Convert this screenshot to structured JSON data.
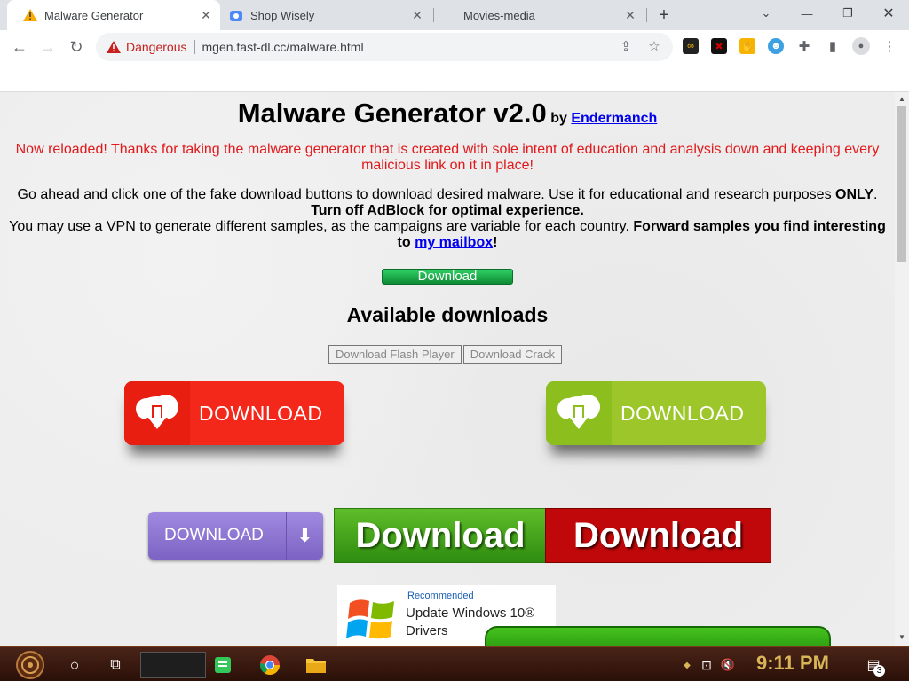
{
  "tabs": [
    {
      "label": "Malware Generator",
      "active": true,
      "icon": "warning-icon"
    },
    {
      "label": "Shop Wisely",
      "active": false,
      "icon": "shop-icon"
    },
    {
      "label": "Movies-media",
      "active": false,
      "icon": ""
    }
  ],
  "omnibox": {
    "security_label": "Dangerous",
    "url": "mgen.fast-dl.cc/malware.html"
  },
  "page": {
    "title": "Malware Generator v2.0",
    "by_prefix": "by",
    "author_link": "Endermanch",
    "red_strong": "Now reloaded!",
    "red_text": " Thanks for taking the malware generator that is created with sole intent of education and analysis down and keeping every malicious link on it in place!",
    "p1_text": "Go ahead and click one of the fake download buttons to download desired malware. Use it for educational and research purposes ",
    "p1_strong": "ONLY",
    "p1_end": ".",
    "p2_strong": "Turn off AdBlock for optimal experience.",
    "p3_text": "You may use a VPN to generate different samples, as the campaigns are variable for each country. ",
    "p3_strong": "Forward samples you find interesting to ",
    "p3_link": "my mailbox",
    "p3_end": "!",
    "download_button": "Download",
    "available_heading": "Available downloads",
    "flash_button": "Download Flash Player",
    "crack_button": "Download Crack",
    "ad_red_label": "DOWNLOAD",
    "ad_lime_label": "DOWNLOAD",
    "ad_purple_label": "DOWNLOAD",
    "ad_green_label": "Download",
    "ad_darkred_label": "Download",
    "win_ad_recommended": "Recommended",
    "win_ad_line1": "Update Windows 10®",
    "win_ad_line2": "Drivers"
  },
  "taskbar": {
    "time": "9:11 PM",
    "notification_count": "3"
  },
  "colors": {
    "danger": "#c5221f",
    "red_text": "#e0191b",
    "link": "#0000ee",
    "ad_red": "#f4281a",
    "ad_lime": "#8cbf1e"
  }
}
